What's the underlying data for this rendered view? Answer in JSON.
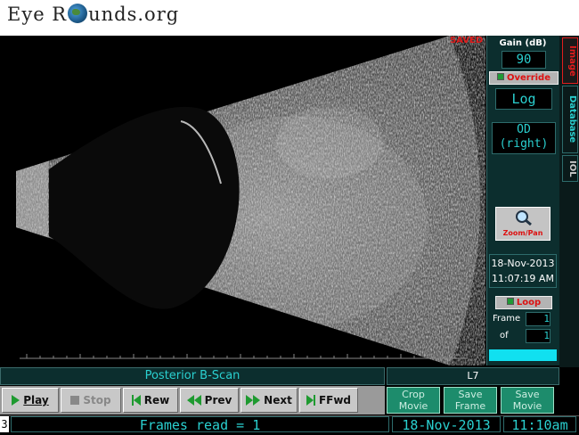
{
  "logo": {
    "part1": "Eye R",
    "part2": "unds.org"
  },
  "status": {
    "saved": "SAVED"
  },
  "side": {
    "gain_label": "Gain (dB)",
    "gain_value": "90",
    "override_label": "Override",
    "scale_value": "Log",
    "eye_line1": "OD",
    "eye_line2": "(right)",
    "zoompan_label": "Zoom/Pan",
    "date": "18-Nov-2013",
    "time": "11:07:19 AM",
    "loop_label": "Loop",
    "frame_label": "Frame",
    "frame_value": "1",
    "of_label": "of",
    "of_value": "1"
  },
  "tabs": {
    "image": "Image",
    "database": "Database",
    "iol": "IOL"
  },
  "scan": {
    "title": "Posterior B-Scan",
    "probe": "L7"
  },
  "controls": {
    "play": "Play",
    "stop": "Stop",
    "rew": "Rew",
    "prev": "Prev",
    "next": "Next",
    "ffwd": "FFwd",
    "crop_movie": "Crop Movie",
    "save_frame": "Save Frame",
    "save_movie": "Save Movie"
  },
  "statusbar": {
    "number": "3",
    "frames": "Frames read = 1",
    "date": "18-Nov-2013",
    "time": "11:10am"
  },
  "colors": {
    "accent": "#2ad0d0",
    "panel": "#0c2e2e",
    "red": "#e21d1d",
    "green_btn": "#1d8c6c"
  }
}
